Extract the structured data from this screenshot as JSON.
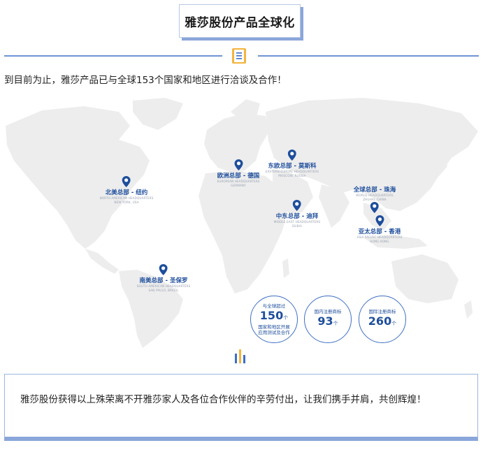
{
  "header": {
    "title": "雅莎股份产品全球化"
  },
  "intro_text": "到目前为止，雅莎产品已与全球153个国家和地区进行洽谈及合作！",
  "headquarters": [
    {
      "cn": "北美总部 - 纽约",
      "en1": "NORTH AMERICAN HEADQUARTERS",
      "en2": "NEW YORK, USA"
    },
    {
      "cn": "欧洲总部 - 德国",
      "en1": "EUROPEAN HEADQUARTERS",
      "en2": "GERMANY"
    },
    {
      "cn": "东欧总部 - 莫斯科",
      "en1": "EASTERN EUROPE HEADQUARTERS",
      "en2": "MOSCOW, RUSSIA"
    },
    {
      "cn": "全球总部 - 珠海",
      "en1": "WORLD HEADQUARTERS",
      "en2": "ZHUHAI, CHINA"
    },
    {
      "cn": "中东总部 - 迪拜",
      "en1": "MIDDLE EAST HEADQUARTERS",
      "en2": "DUBAI"
    },
    {
      "cn": "亚太总部 - 香港",
      "en1": "ASIA PACIFIC HEADQUARTERS",
      "en2": "HONG KONG"
    },
    {
      "cn": "南美总部 - 圣保罗",
      "en1": "SOUTH AMERICAN HEADQUARTERS",
      "en2": "SAN PAULO, BRAZIL"
    }
  ],
  "stats": [
    {
      "top": "与全球超过",
      "num": "150",
      "unit": "个",
      "bottom1": "国家和地区开展",
      "bottom2": "应用测试及合作"
    },
    {
      "top": "国内注册商标",
      "num": "93",
      "unit": "个",
      "bottom1": "",
      "bottom2": ""
    },
    {
      "top": "国际注册商标",
      "num": "260",
      "unit": "个",
      "bottom1": "",
      "bottom2": ""
    }
  ],
  "footer_text": "雅莎股份获得以上殊荣离不开雅莎家人及各位合作伙伴的辛劳付出，让我们携手并肩，共创辉煌！",
  "colors": {
    "accent": "#1e4e9c",
    "line": "#6f93d6",
    "map": "#eeeeee"
  },
  "icons": [
    "scroll-icon",
    "location-pin-icon",
    "bar-chart-icon"
  ]
}
